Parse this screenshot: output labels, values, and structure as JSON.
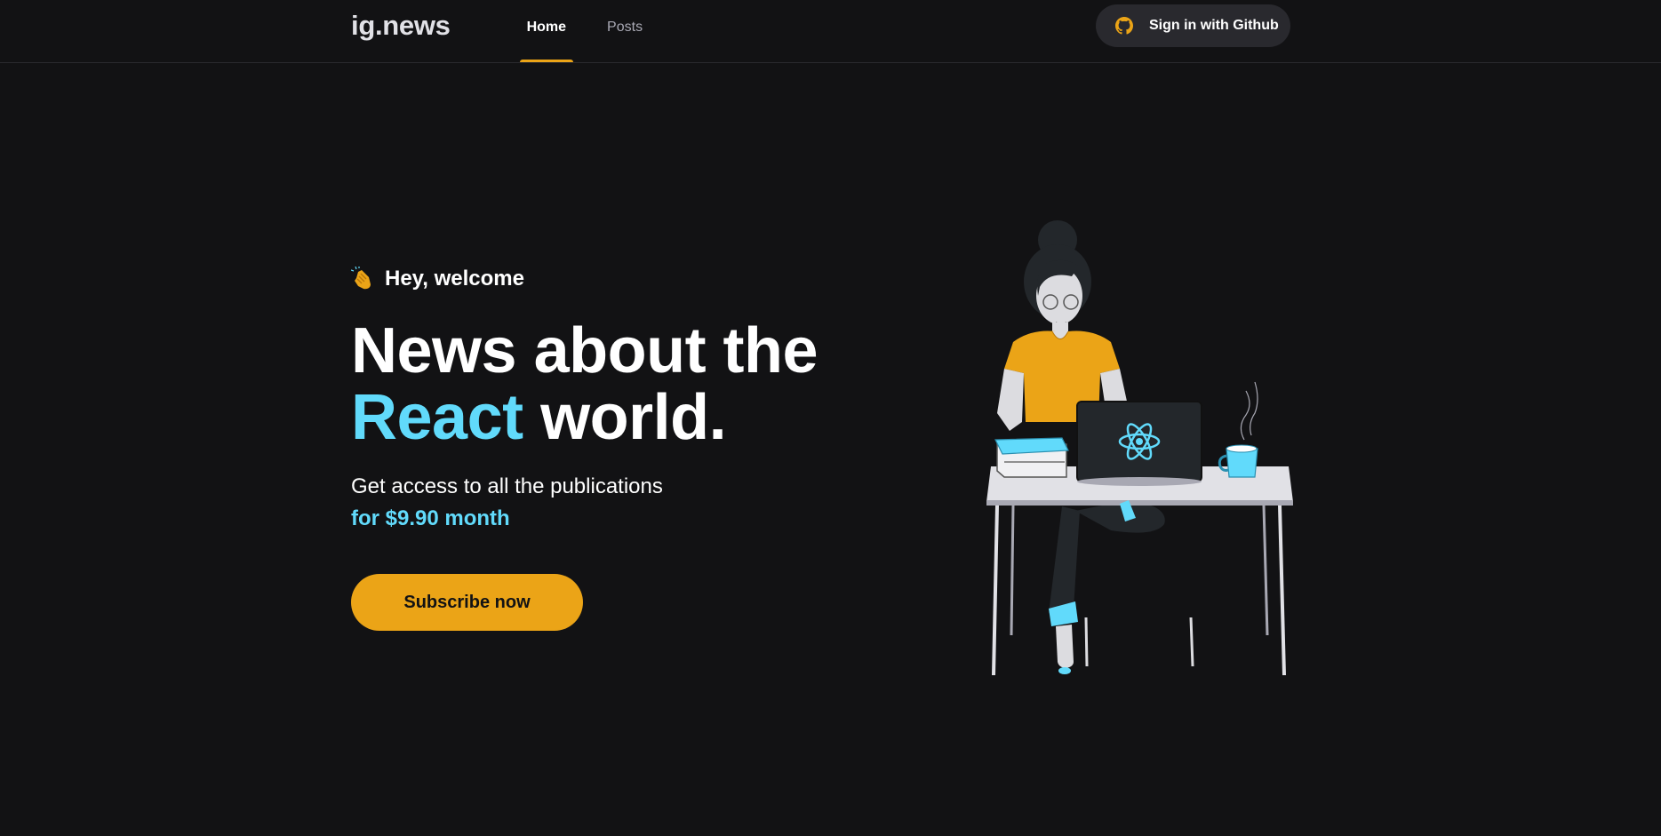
{
  "header": {
    "logo": "ig.news",
    "nav": [
      {
        "label": "Home",
        "active": true
      },
      {
        "label": "Posts",
        "active": false
      }
    ],
    "signin_label": "Sign in with Github",
    "signin_icon": "github-icon"
  },
  "hero": {
    "welcome_icon": "clapping-hands-icon",
    "welcome": "Hey, welcome",
    "headline_line1": "News about the",
    "headline_accent": "React",
    "headline_line2_rest": " world.",
    "sub": "Get access to all the publications",
    "price": "for $9.90 month",
    "cta_label": "Subscribe now"
  },
  "colors": {
    "background": "#121214",
    "accent_yellow": "#eba417",
    "accent_cyan": "#61dafb",
    "button_dark": "#29292e"
  }
}
